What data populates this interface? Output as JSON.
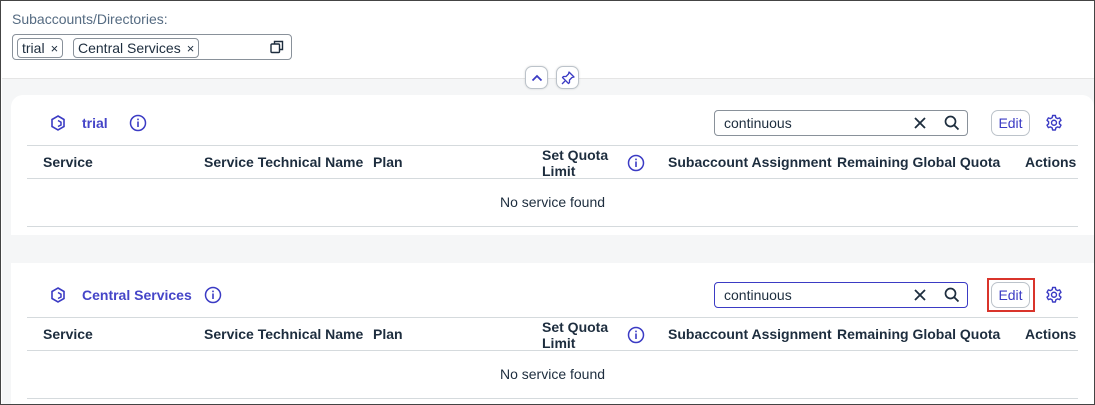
{
  "filter": {
    "label": "Subaccounts/Directories:",
    "tokens": [
      "trial",
      "Central Services"
    ],
    "token_remove": "×"
  },
  "columns": {
    "service": "Service",
    "technical_name": "Service Technical Name",
    "plan": "Plan",
    "quota_limit_line1": "Set Quota",
    "quota_limit_line2": "Limit",
    "subaccount_assignment": "Subaccount Assignment",
    "remaining_global_quota": "Remaining Global Quota",
    "actions": "Actions"
  },
  "sections": [
    {
      "title": "trial",
      "search_value": "continuous",
      "edit_label": "Edit",
      "empty_text": "No service found"
    },
    {
      "title": "Central Services",
      "search_value": "continuous",
      "edit_label": "Edit",
      "empty_text": "No service found"
    }
  ],
  "icons": {
    "subaccount": "subaccount-icon",
    "info": "info-icon",
    "clear": "clear-icon",
    "search": "search-icon",
    "settings": "gear-icon",
    "collapse": "chevron-up-icon",
    "pin": "pin-icon",
    "copy": "copy-icon"
  },
  "colors": {
    "accent": "#3b3bc4",
    "title": "#4545c8",
    "highlight": "#d9342b",
    "background": "#f5f6f7"
  }
}
